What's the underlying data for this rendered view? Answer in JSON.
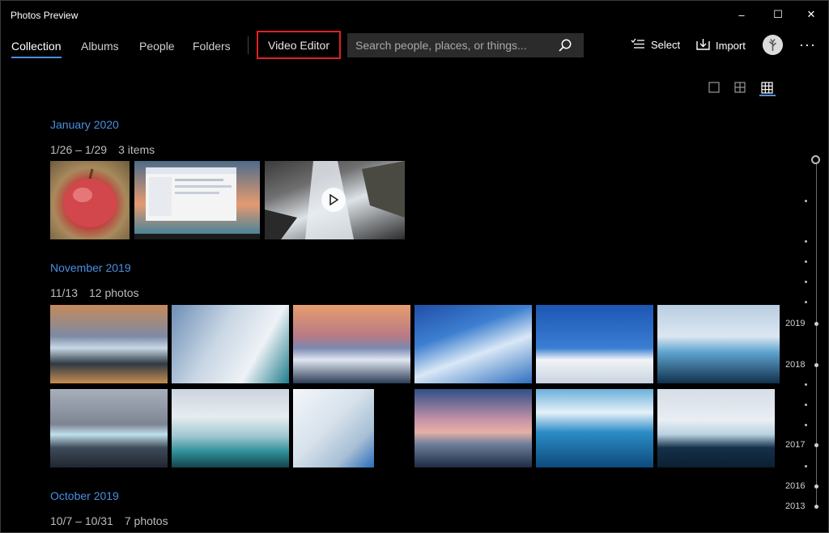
{
  "app": {
    "title": "Photos Preview"
  },
  "window_controls": {
    "minimize": "–",
    "maximize": "☐",
    "close": "✕"
  },
  "nav": {
    "tabs": [
      {
        "label": "Collection",
        "active": true
      },
      {
        "label": "Albums"
      },
      {
        "label": "People"
      },
      {
        "label": "Folders"
      }
    ],
    "video_editor": "Video Editor",
    "search_placeholder": "Search people, places, or things...",
    "select_label": "Select",
    "import_label": "Import",
    "more": "···"
  },
  "view_modes": [
    "single",
    "medium-grid",
    "small-grid"
  ],
  "active_view": "small-grid",
  "sections": [
    {
      "month": "January 2020",
      "date_range": "1/26 – 1/29",
      "count": "3 items"
    },
    {
      "month": "November 2019",
      "date_range": "11/13",
      "count": "12 photos"
    },
    {
      "month": "October 2019",
      "date_range": "10/7 – 10/31",
      "count": "7 photos"
    }
  ],
  "timeline": {
    "years": [
      "2019",
      "2018",
      "2017",
      "2016",
      "2013"
    ]
  },
  "colors": {
    "accent": "#4a8fe0",
    "highlight": "#e0221f",
    "background": "#000000"
  }
}
